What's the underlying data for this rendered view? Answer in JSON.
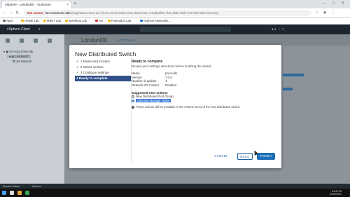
{
  "browser": {
    "tab_title": "vSphere - LondonDC - Summary",
    "address": {
      "warning": "Not secure",
      "host": "lon-vcsa.home.lab",
      "path": "/ui/app/datacenter;nav=h/urn:vmomi:Datacenter:datacenter-3:5dda6f56-4f45-49bb-ab9f-ec87387ca6fc/summary"
    },
    "bookmarks": [
      {
        "label": "Apps",
        "color": "#5f6368"
      },
      {
        "label": "HOME Lab",
        "color": "#f4b400"
      },
      {
        "label": "MSNT Lab",
        "color": "#f4b400"
      },
      {
        "label": "workshop Lab",
        "color": "#f4b400"
      },
      {
        "label": "Ani",
        "color": "#d93025"
      },
      {
        "label": "Federation Lab",
        "color": "#f4b400"
      },
      {
        "label": "vSphere Networkin...",
        "color": "#1a73e8"
      }
    ]
  },
  "vsphere": {
    "app_name": "vSphere Client",
    "page_title": "LondonDC",
    "actions_label": "ACTIONS",
    "tree": [
      "lon-vcsa.home.lab",
      "LondonDC",
      "VM Network"
    ],
    "recent_tasks": "Recent Tasks",
    "alarms": "Alarms"
  },
  "wizard": {
    "title": "New Distributed Switch",
    "steps": [
      {
        "label": "1 Name and location",
        "done": true
      },
      {
        "label": "2 Select version",
        "done": true
      },
      {
        "label": "3 Configure settings",
        "done": true
      },
      {
        "label": "4 Ready to complete",
        "done": false,
        "active": true
      }
    ],
    "content_title": "Ready to complete",
    "content_subtitle": "Review your settings selections before finishing the wizard.",
    "settings": [
      {
        "key": "Name",
        "value": "prod-vds"
      },
      {
        "key": "Version",
        "value": "7.0.0"
      },
      {
        "key": "Number of uplinks",
        "value": "4"
      },
      {
        "key": "Network I/O Control",
        "value": "Enabled"
      }
    ],
    "suggested_title": "Suggested next actions",
    "suggested": [
      {
        "label": "New Distributed Port Group",
        "selected": false
      },
      {
        "label": "Add and Manage Hosts",
        "selected": true
      }
    ],
    "info_text": "These actions will be available in the Actions menu of the new distributed switch.",
    "buttons": {
      "cancel": "CANCEL",
      "back": "BACK",
      "finish": "FINISH"
    }
  },
  "taskbar": {
    "time": "6:03 PM",
    "date": "2/16/2021"
  }
}
